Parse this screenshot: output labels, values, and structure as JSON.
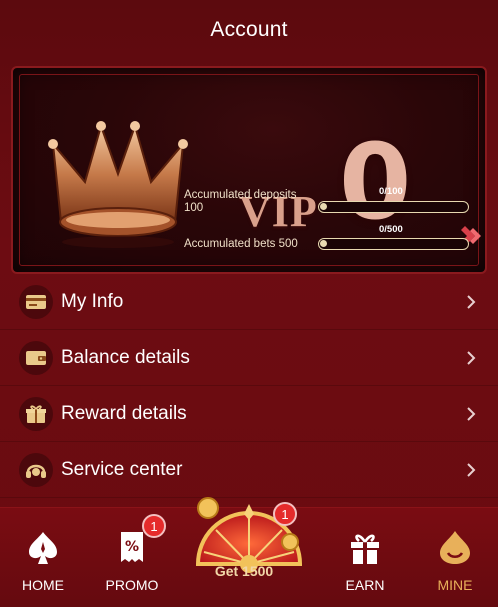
{
  "header": {
    "title": "Account"
  },
  "vip": {
    "word": "VIP",
    "level": "0",
    "deposits_label": "Accumulated deposits 100",
    "deposits_progress": "0/100",
    "deposits_fraction": 0,
    "bets_label": "Accumulated bets 500",
    "bets_progress": "0/500",
    "bets_fraction": 0
  },
  "menu": {
    "items": [
      {
        "label": "My Info",
        "icon": "id-card-icon"
      },
      {
        "label": "Balance details",
        "icon": "wallet-icon"
      },
      {
        "label": "Reward details",
        "icon": "gift-icon"
      },
      {
        "label": "Service center",
        "icon": "headset-icon"
      }
    ]
  },
  "nav": {
    "home": "HOME",
    "promo": "PROMO",
    "promo_badge": "1",
    "wheel_label": "Get 1500",
    "wheel_badge": "1",
    "earn": "EARN",
    "mine": "MINE"
  },
  "colors": {
    "background": "#6a0b10",
    "accent": "#e8b05a",
    "badge": "#e52b2b"
  }
}
